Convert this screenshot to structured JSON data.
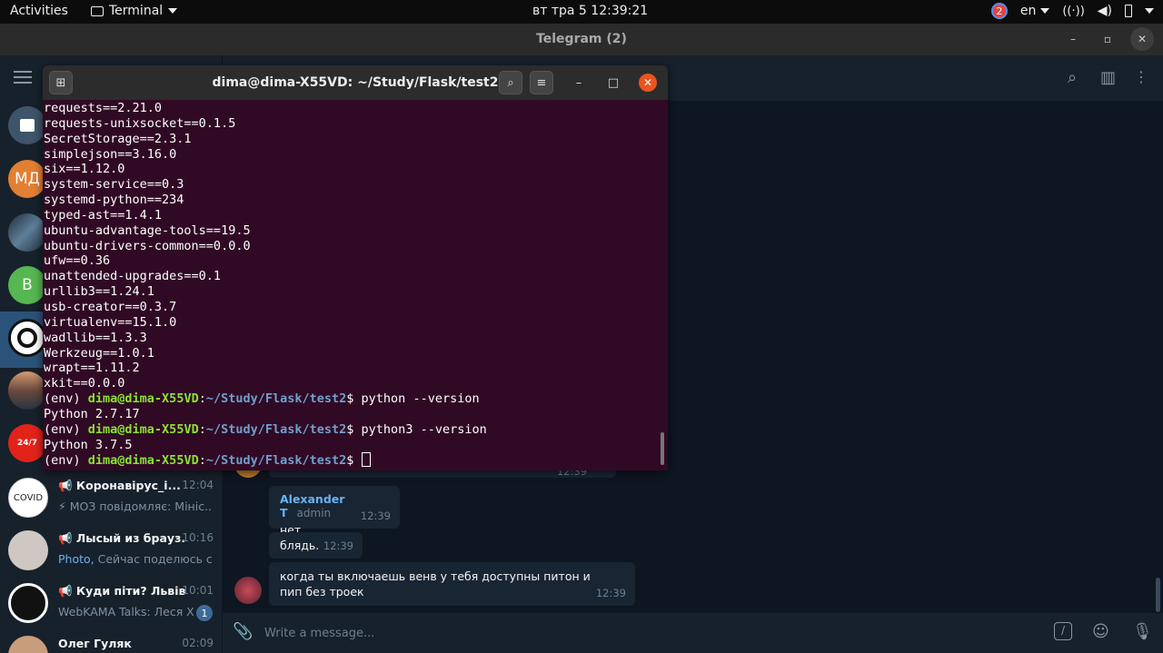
{
  "topbar": {
    "activities": "Activities",
    "app_menu": "Terminal",
    "clock": "вт тра  5  12:39:21",
    "notification_count": "2",
    "language": "en"
  },
  "telegram": {
    "window_title": "Telegram (2)",
    "sidebar": {
      "avatars": [
        {
          "label": "",
          "color": "#3e546a"
        },
        {
          "label": "МД",
          "color": "#e17f33"
        },
        {
          "label": "",
          "color": "#34495e"
        },
        {
          "label": "B",
          "color": "#56b651"
        },
        {
          "label": "",
          "color": "#eeeeee"
        },
        {
          "label": "",
          "color": "#7a5a4a"
        },
        {
          "label": "",
          "color": "#e2231a"
        }
      ],
      "chats": [
        {
          "name": "Коронавірус_і...",
          "time": "12:04",
          "preview": "⚡ МОЗ повідомляє:  Мініс...",
          "preview_highlight": "",
          "unread": ""
        },
        {
          "name": "Лысый из брауз...",
          "time": "10:16",
          "preview": " Сейчас поделюсь с ...",
          "preview_highlight": "Photo,",
          "unread": ""
        },
        {
          "name": "Куди піти? Львів",
          "time": "10:01",
          "preview": "WebKAMA Talks: Леся Х...",
          "preview_highlight": "",
          "unread": "1"
        },
        {
          "name": "Олег Гуляк",
          "time": "02:09",
          "preview": "",
          "preview_highlight": "",
          "unread": ""
        }
      ]
    },
    "messages": [
      {
        "author": "Alexander T",
        "role": "admin",
        "text": "нет",
        "time": "12:39"
      },
      {
        "author": "",
        "role": "",
        "text": "блядь.",
        "time": "12:39"
      },
      {
        "author": "",
        "role": "",
        "text": "когда ты включаешь венв у тебя доступны питон и пип без троек",
        "time": "12:39"
      }
    ],
    "partial_message_time": "12:39",
    "composer_placeholder": "Write a message..."
  },
  "terminal": {
    "title": "dima@dima-X55VD: ~/Study/Flask/test2",
    "lines": [
      "requests==2.21.0",
      "requests-unixsocket==0.1.5",
      "SecretStorage==2.3.1",
      "simplejson==3.16.0",
      "six==1.12.0",
      "system-service==0.3",
      "systemd-python==234",
      "typed-ast==1.4.1",
      "ubuntu-advantage-tools==19.5",
      "ubuntu-drivers-common==0.0.0",
      "ufw==0.36",
      "unattended-upgrades==0.1",
      "urllib3==1.24.1",
      "usb-creator==0.3.7",
      "virtualenv==15.1.0",
      "wadllib==1.3.3",
      "Werkzeug==1.0.1",
      "wrapt==1.11.2",
      "xkit==0.0.0"
    ],
    "prompt_env": "(env) ",
    "prompt_user": "dima@dima-X55VD",
    "prompt_path": "~/Study/Flask/test2",
    "cmd1": "python --version",
    "out1": "Python 2.7.17",
    "cmd2": "python3 --version",
    "out2": "Python 3.7.5"
  }
}
